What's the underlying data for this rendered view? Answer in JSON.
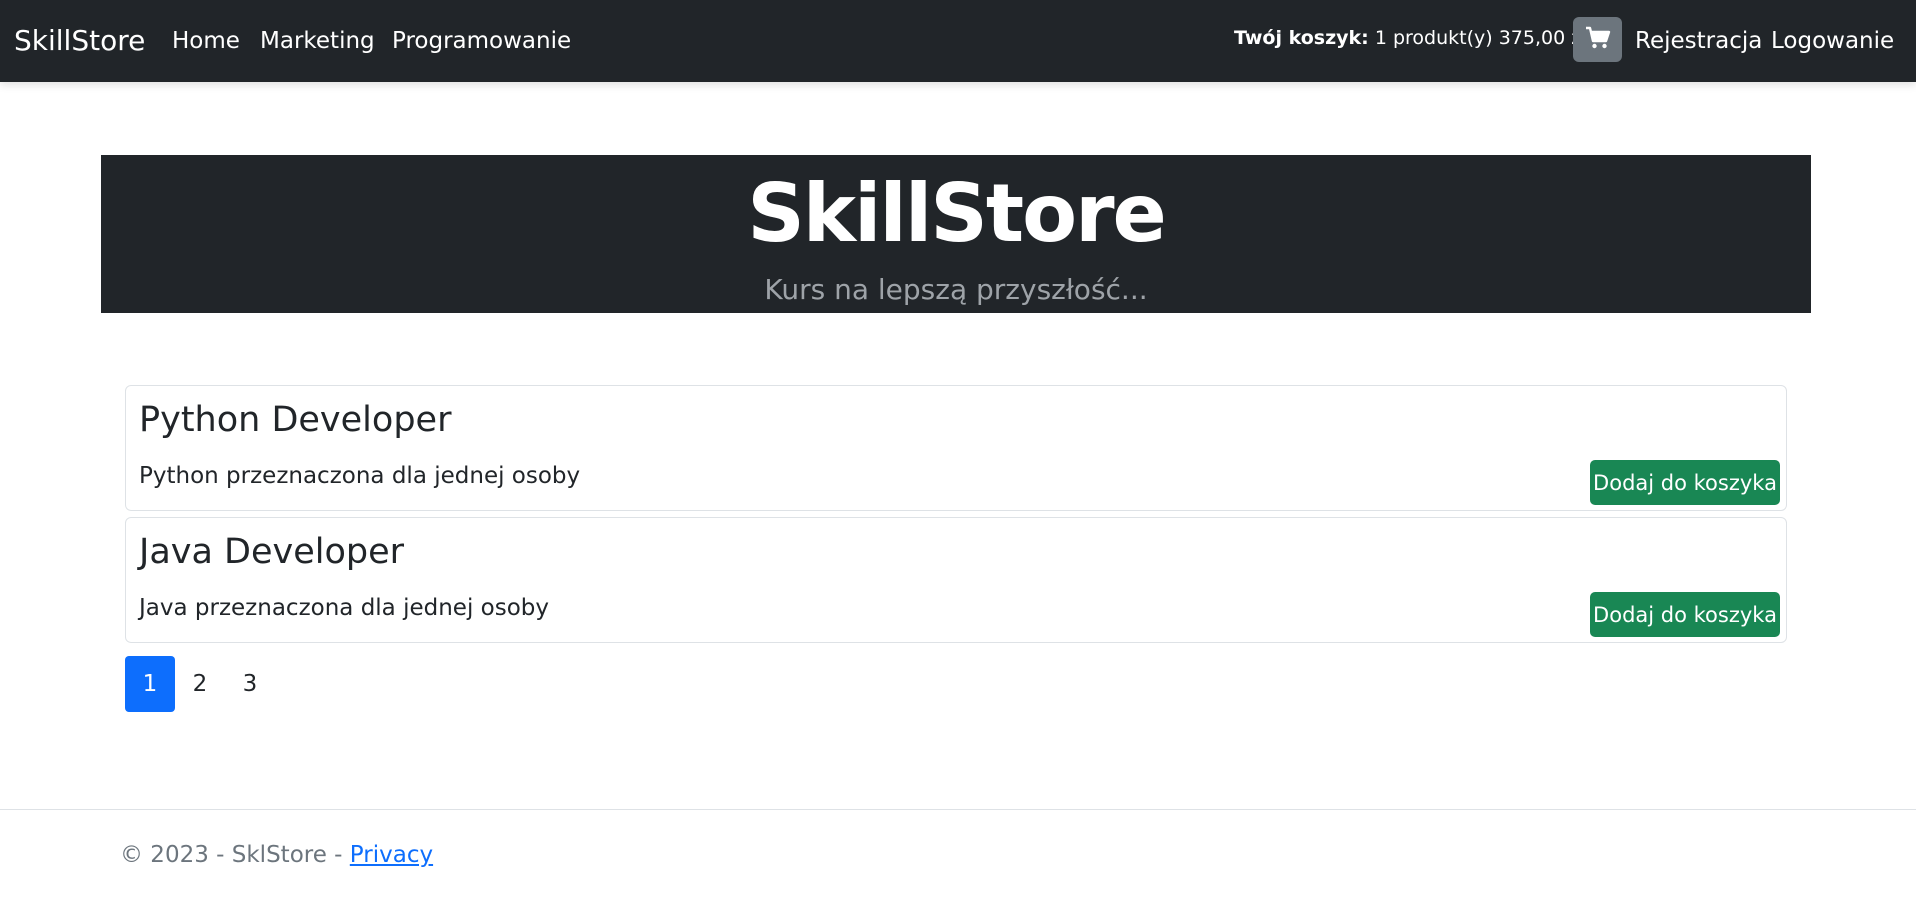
{
  "navbar": {
    "brand": "SkillStore",
    "links": [
      "Home",
      "Marketing",
      "Programowanie"
    ],
    "cart_label": "Twój koszyk:",
    "cart_info": "1 produkt(y) 375,00 zł",
    "register": "Rejestracja",
    "login": "Logowanie"
  },
  "hero": {
    "title": "SkillStore",
    "subtitle": "Kurs na lepszą przyszłość..."
  },
  "products": [
    {
      "title": "Python Developer",
      "description": "Python przeznaczona dla jednej osoby",
      "button": "Dodaj do koszyka"
    },
    {
      "title": "Java Developer",
      "description": "Java przeznaczona dla jednej osoby",
      "button": "Dodaj do koszyka"
    }
  ],
  "pagination": {
    "pages": [
      "1",
      "2",
      "3"
    ],
    "active": "1"
  },
  "footer": {
    "text": "© 2023 - SklStore - ",
    "privacy": "Privacy"
  },
  "colors": {
    "navbar_bg": "#212529",
    "cart_button_bg": "#6c757d",
    "add_button_bg": "#198754",
    "active_page_bg": "#0d6efd",
    "link": "#0d6efd"
  },
  "icons": {
    "cart": "shopping-cart-icon"
  }
}
